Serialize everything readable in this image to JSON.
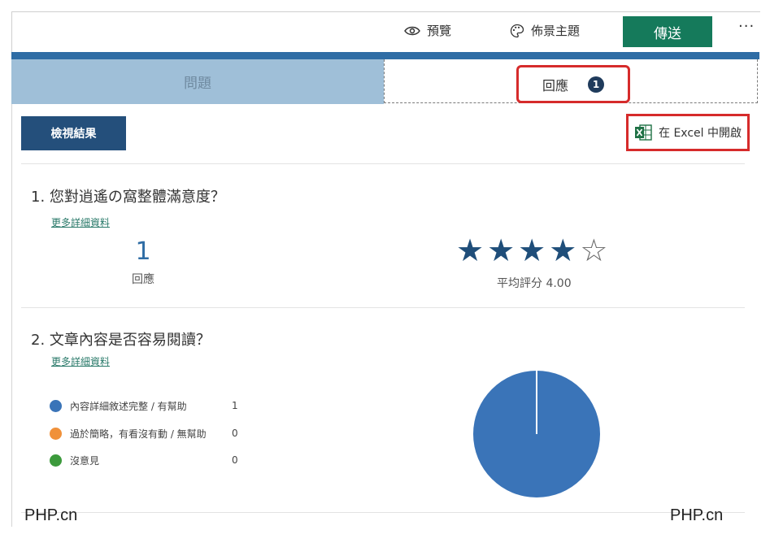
{
  "toolbar": {
    "preview_label": "預覽",
    "theme_label": "佈景主題",
    "send_label": "傳送",
    "more_label": "···"
  },
  "tabs": {
    "questions_label": "問題",
    "responses_label": "回應",
    "responses_badge": "1"
  },
  "actions": {
    "view_results_label": "檢視結果",
    "open_excel_label": "在 Excel 中開啟"
  },
  "q1": {
    "number": "1.",
    "title": "您對逍遙の窩整體滿意度？",
    "more_details": "更多詳細資料",
    "response_count": "1",
    "response_label": "回應",
    "rating": 4,
    "rating_max": 5,
    "average_label": "平均評分 4.00"
  },
  "q2": {
    "number": "2.",
    "title": "文章內容是否容易閱讀？",
    "more_details": "更多詳細資料",
    "options": [
      {
        "label": "內容詳細敘述完整 / 有幫助",
        "count": "1",
        "color": "#3a74b8"
      },
      {
        "label": "過於簡略，有看沒有動 / 無幫助",
        "count": "0",
        "color": "#f0913a"
      },
      {
        "label": "沒意見",
        "count": "0",
        "color": "#3c9a3c"
      }
    ]
  },
  "chart_data": {
    "type": "pie",
    "categories": [
      "內容詳細敘述完整 / 有幫助",
      "過於簡略，有看沒有動 / 無幫助",
      "沒意見"
    ],
    "values": [
      1,
      0,
      0
    ],
    "colors": [
      "#3a74b8",
      "#f0913a",
      "#3c9a3c"
    ]
  },
  "watermark": {
    "left": "PHP.cn",
    "right": "PHP.cn"
  }
}
